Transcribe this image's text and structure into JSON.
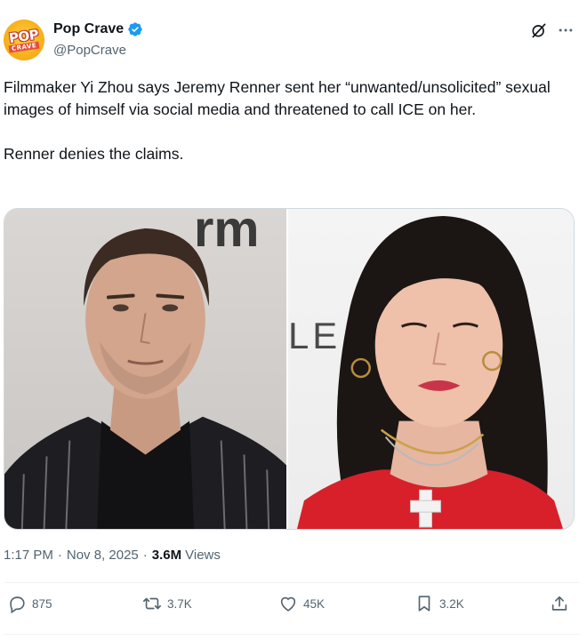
{
  "author": {
    "display_name": "Pop Crave",
    "handle": "@PopCrave",
    "verified": true,
    "avatar_text_top": "POP",
    "avatar_text_bottom": "CRAVE",
    "avatar_icon": "pop-crave-logo"
  },
  "header_icons": [
    "grok-icon",
    "more-icon"
  ],
  "tweet": {
    "text": "Filmmaker Yi Zhou says Jeremy Renner sent her “unwanted/unsolicited” sexual images of himself via social media and threatened to call ICE on her.\n\nRenner denies the claims."
  },
  "media": {
    "left_photo_backdrop_text": "rm",
    "right_photo_backdrop_text": "LE"
  },
  "meta": {
    "time": "1:17 PM",
    "date": "Nov 8, 2025",
    "separator": "·",
    "views_count": "3.6M",
    "views_label": "Views"
  },
  "actions": {
    "reply_count": "875",
    "retweet_count": "3.7K",
    "like_count": "45K",
    "bookmark_count": "3.2K"
  },
  "colors": {
    "text_primary": "#0f1419",
    "text_secondary": "#536471",
    "verified_blue": "#1d9bf0",
    "divider": "#eff3f4"
  }
}
